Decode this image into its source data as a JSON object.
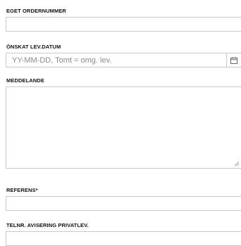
{
  "fields": {
    "order_number": {
      "label": "EGET ORDERNUMMER",
      "value": ""
    },
    "delivery_date": {
      "label": "ÖNSKAT LEV.DATUM",
      "placeholder": "YY-MM-DD, Tomt = omg. lev.",
      "icon": "calendar-icon"
    },
    "message": {
      "label": "MEDDELANDE",
      "value": ""
    },
    "reference": {
      "label": "REFERENS*",
      "value": ""
    },
    "phone_notification": {
      "label": "TELNR. AVISERING PRIVATLEV.",
      "value": ""
    }
  }
}
